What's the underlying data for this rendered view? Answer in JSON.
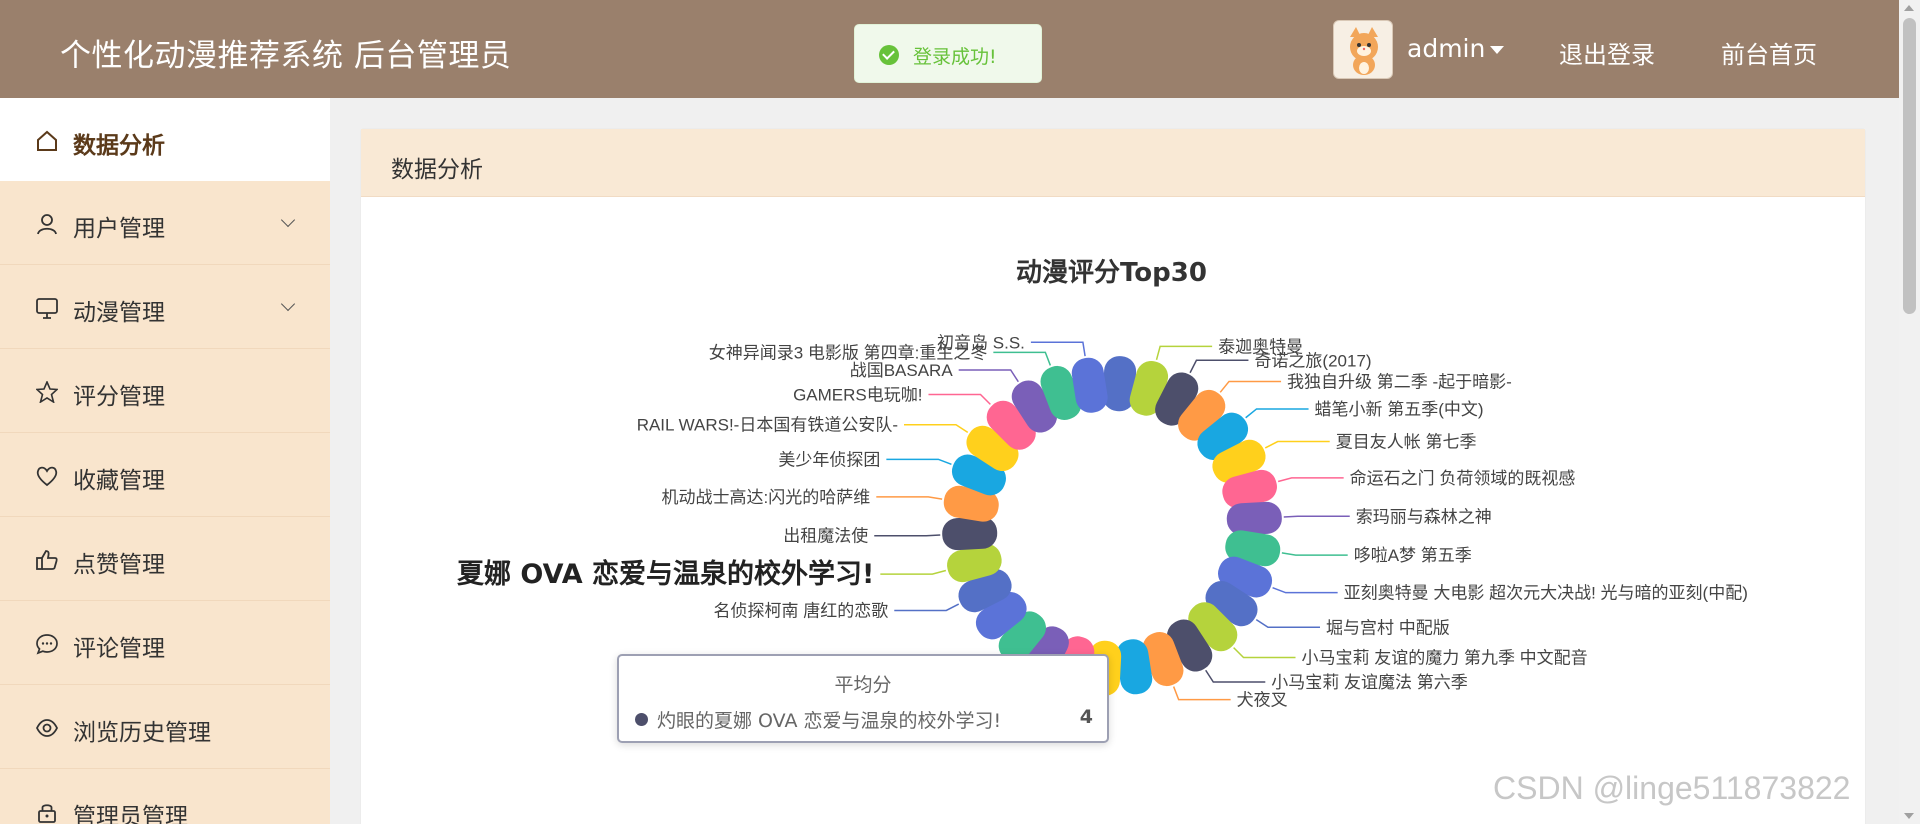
{
  "header": {
    "title": "个性化动漫推荐系统 后台管理员",
    "username": "admin",
    "logout_label": "退出登录",
    "home_label": "前台首页"
  },
  "toast": {
    "message": "登录成功!"
  },
  "sidebar": {
    "items": [
      {
        "label": "数据分析",
        "icon": "home-icon",
        "active": true
      },
      {
        "label": "用户管理",
        "icon": "user-icon",
        "expandable": true
      },
      {
        "label": "动漫管理",
        "icon": "monitor-icon",
        "expandable": true
      },
      {
        "label": "评分管理",
        "icon": "star-icon"
      },
      {
        "label": "收藏管理",
        "icon": "heart-icon"
      },
      {
        "label": "点赞管理",
        "icon": "thumbs-up-icon"
      },
      {
        "label": "评论管理",
        "icon": "comment-icon"
      },
      {
        "label": "浏览历史管理",
        "icon": "eye-icon"
      },
      {
        "label": "管理员管理",
        "icon": "lock-icon"
      }
    ]
  },
  "main": {
    "card_title": "数据分析"
  },
  "chart_data": {
    "type": "bar",
    "title": "动漫评分Top30",
    "polar": true,
    "highlighted": "夏娜 OVA 恋爱与温泉的校外学习!",
    "colors": [
      "#5470c6",
      "#b5d33c",
      "#4d4f6b",
      "#ff9a45",
      "#19a7e1",
      "#ffd01c",
      "#ff6692",
      "#7a5fb8",
      "#3fbf91",
      "#5b73d8"
    ],
    "categories": [
      "泰迦奥特曼",
      "奇诺之旅(2017)",
      "我独自升级 第二季 -起于暗影-",
      "蜡笔小新 第五季(中文)",
      "夏目友人帐 第七季",
      "命运石之门 负荷领域的既视感",
      "索玛丽与森林之神",
      "哆啦A梦 第五季",
      "亚刻奥特曼 大电影 超次元大决战! 光与暗的亚刻(中配)",
      "堀与宫村 中配版",
      "小马宝莉 友谊的魔力 第九季 中文配音",
      "小马宝莉 友谊魔法 第六季",
      "犬夜叉",
      "名侦探柯南 唐红的恋歌",
      "夏娜 OVA 恋爱与温泉的校外学习!",
      "出租魔法使",
      "机动战士高达:闪光的哈萨维",
      "美少年侦探团",
      "RAIL WARS!-日本国有铁道公安队-",
      "GAMERS电玩咖!",
      "战国BASARA",
      "女神异闻录3 电影版 第四章:重生之冬",
      "初音岛 S.S."
    ]
  },
  "tooltip": {
    "title": "平均分",
    "name": "灼眼的夏娜 OVA 恋爱与温泉的校外学习!",
    "value": "4"
  },
  "watermark": "CSDN @linge511873822"
}
